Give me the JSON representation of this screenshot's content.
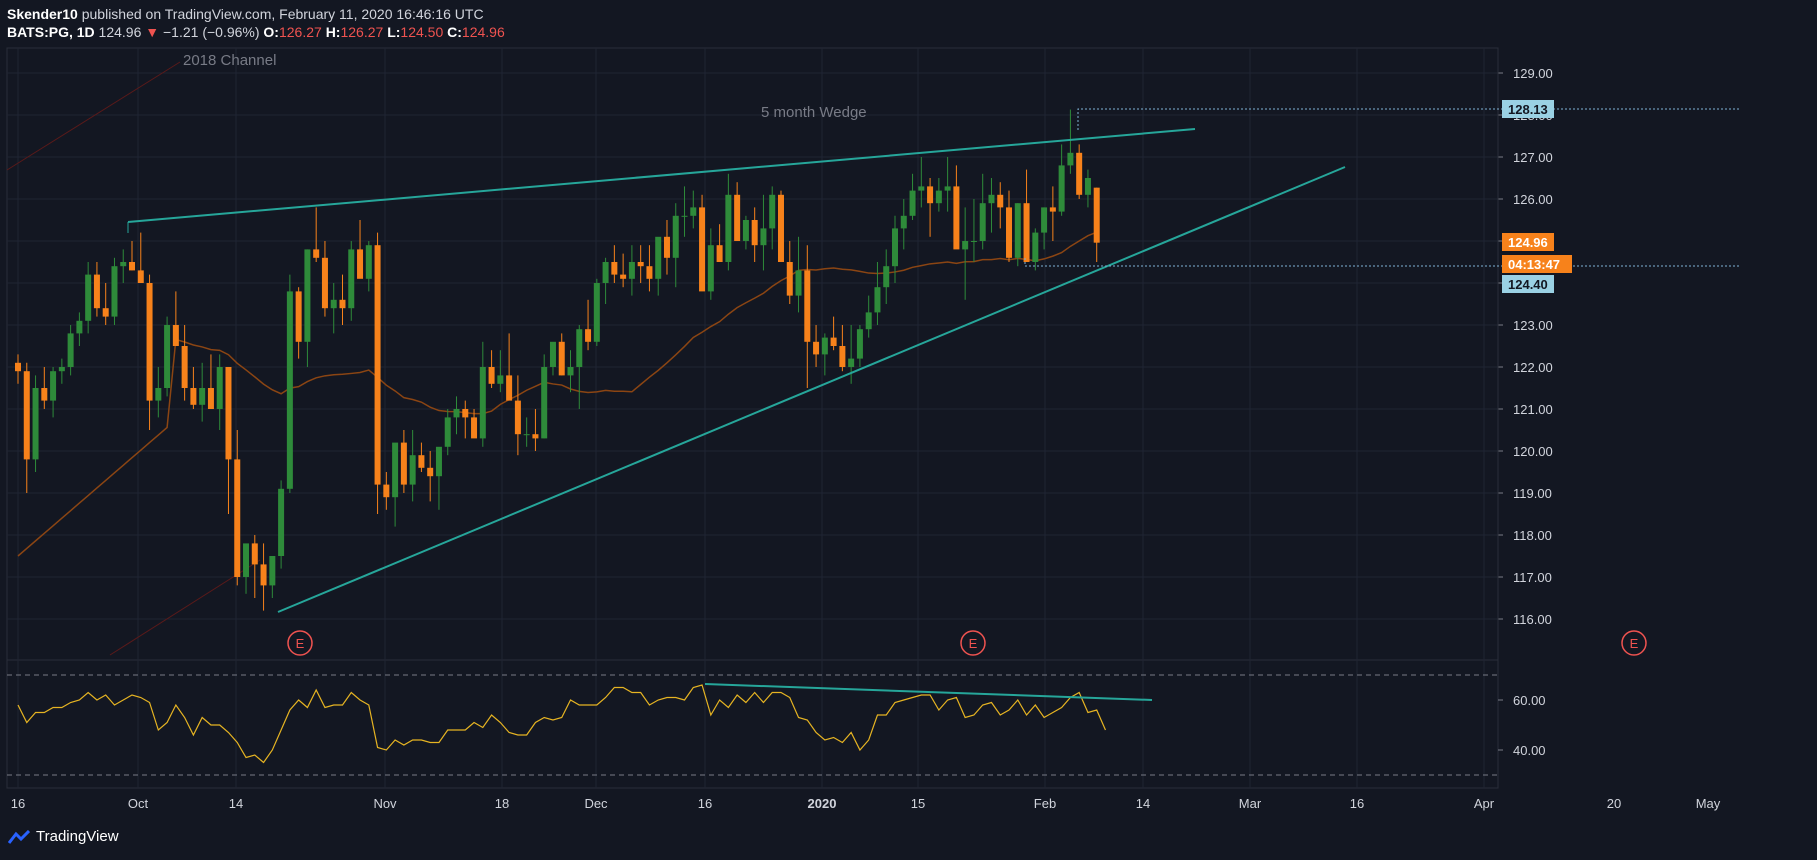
{
  "header": {
    "author": "Skender10",
    "published": "published on TradingView.com, February 11, 2020 16:46:16 UTC",
    "symbol": "BATS:PG, 1D",
    "last": "124.96",
    "arrow": "▼",
    "change": "−1.21 (−0.96%)",
    "o_label": "O:",
    "o_val": "126.27",
    "h_label": "H:",
    "h_val": "126.27",
    "l_label": "L:",
    "l_val": "124.50",
    "c_label": "C:",
    "c_val": "124.96"
  },
  "footer": {
    "brand": "TradingView"
  },
  "colors": {
    "background": "#131722",
    "up": "#2e8b3a",
    "down": "#f7821b",
    "trendline": "#26a69a",
    "ma": "#8b4513",
    "rsi": "#e6b422",
    "earnings": "#ef5350",
    "grid": "#1f2433"
  },
  "chart_data": {
    "type": "candlestick",
    "y_ticks": [
      "129.00",
      "128.00",
      "127.00",
      "126.00",
      "125.00",
      "124.00",
      "123.00",
      "122.00",
      "121.00",
      "120.00",
      "119.00",
      "118.00",
      "117.00",
      "116.00"
    ],
    "ylim": [
      115.0,
      129.5
    ],
    "x_ticks": [
      "16",
      "Oct",
      "14",
      "Nov",
      "18",
      "Dec",
      "16",
      "2020",
      "15",
      "Feb",
      "14",
      "Mar",
      "16",
      "Apr",
      "20",
      "May"
    ],
    "price_labels": {
      "high_mark": "128.13",
      "last": "124.96",
      "countdown": "04:13:47",
      "low_mark": "124.40"
    },
    "annotations": {
      "wedge": "5 month Wedge",
      "channel": "2018 Channel",
      "earnings": "E"
    },
    "candles": [
      [
        122.1,
        122.3,
        121.6,
        121.9
      ],
      [
        121.9,
        122.1,
        119.0,
        119.8
      ],
      [
        119.8,
        121.8,
        119.5,
        121.5
      ],
      [
        121.5,
        122.0,
        121.0,
        121.2
      ],
      [
        121.2,
        122.0,
        120.8,
        121.9
      ],
      [
        121.9,
        122.2,
        121.6,
        122.0
      ],
      [
        122.0,
        123.0,
        121.8,
        122.8
      ],
      [
        122.8,
        123.3,
        122.5,
        123.1
      ],
      [
        123.1,
        124.5,
        122.8,
        124.2
      ],
      [
        124.2,
        124.5,
        123.2,
        123.4
      ],
      [
        123.4,
        124.0,
        123.0,
        123.2
      ],
      [
        123.2,
        124.6,
        123.0,
        124.4
      ],
      [
        124.4,
        124.8,
        124.0,
        124.5
      ],
      [
        124.5,
        125.0,
        124.3,
        124.3
      ],
      [
        124.3,
        125.2,
        124.0,
        124.0
      ],
      [
        124.0,
        124.2,
        120.5,
        121.2
      ],
      [
        121.2,
        122.0,
        120.8,
        121.5
      ],
      [
        121.5,
        123.2,
        121.3,
        123.0
      ],
      [
        123.0,
        123.8,
        122.5,
        122.5
      ],
      [
        122.5,
        123.0,
        121.2,
        121.5
      ],
      [
        121.5,
        122.0,
        121.0,
        121.1
      ],
      [
        121.1,
        122.1,
        120.7,
        121.5
      ],
      [
        121.5,
        122.3,
        121.2,
        121.0
      ],
      [
        121.0,
        122.3,
        120.5,
        122.0
      ],
      [
        122.0,
        122.0,
        118.5,
        119.8
      ],
      [
        119.8,
        120.5,
        116.8,
        117.0
      ],
      [
        117.0,
        117.2,
        116.6,
        117.8
      ],
      [
        117.8,
        118.0,
        116.5,
        117.3
      ],
      [
        117.3,
        117.8,
        116.2,
        116.8
      ],
      [
        116.8,
        117.5,
        116.5,
        117.5
      ],
      [
        117.5,
        119.3,
        117.2,
        119.1
      ],
      [
        119.1,
        124.2,
        119.0,
        123.8
      ],
      [
        123.8,
        123.9,
        122.2,
        122.6
      ],
      [
        122.6,
        124.8,
        122.0,
        124.8
      ],
      [
        124.8,
        125.8,
        124.5,
        124.6
      ],
      [
        124.6,
        125.0,
        123.2,
        123.4
      ],
      [
        123.4,
        124.0,
        122.8,
        123.6
      ],
      [
        123.6,
        124.2,
        123.0,
        123.4
      ],
      [
        123.4,
        125.0,
        123.1,
        124.8
      ],
      [
        124.8,
        125.5,
        124.2,
        124.1
      ],
      [
        124.1,
        125.0,
        123.8,
        124.9
      ],
      [
        124.9,
        125.2,
        118.5,
        119.2
      ],
      [
        119.2,
        119.5,
        118.6,
        118.9
      ],
      [
        118.9,
        119.2,
        118.2,
        120.2
      ],
      [
        120.2,
        120.5,
        119.0,
        119.2
      ],
      [
        119.2,
        120.5,
        118.8,
        119.9
      ],
      [
        119.9,
        120.2,
        119.5,
        119.6
      ],
      [
        119.6,
        120.0,
        118.8,
        119.4
      ],
      [
        119.4,
        119.6,
        118.6,
        120.1
      ],
      [
        120.1,
        121.0,
        119.9,
        120.8
      ],
      [
        120.8,
        121.3,
        120.4,
        121.0
      ],
      [
        121.0,
        121.2,
        120.3,
        120.8
      ],
      [
        120.8,
        121.0,
        120.4,
        120.3
      ],
      [
        120.3,
        122.6,
        120.1,
        122.0
      ],
      [
        122.0,
        122.4,
        121.5,
        121.6
      ],
      [
        121.6,
        122.4,
        121.4,
        121.8
      ],
      [
        121.8,
        122.8,
        121.5,
        121.2
      ],
      [
        121.2,
        121.8,
        119.9,
        120.4
      ],
      [
        120.4,
        120.8,
        120.1,
        120.4
      ],
      [
        120.4,
        121.0,
        120.0,
        120.3
      ],
      [
        120.3,
        122.3,
        120.3,
        122.0
      ],
      [
        122.0,
        122.5,
        121.8,
        122.6
      ],
      [
        122.6,
        122.8,
        121.8,
        121.8
      ],
      [
        121.8,
        122.4,
        121.4,
        122.0
      ],
      [
        122.0,
        123.0,
        121.0,
        122.9
      ],
      [
        122.9,
        123.6,
        122.4,
        122.6
      ],
      [
        122.6,
        124.1,
        122.5,
        124.0
      ],
      [
        124.0,
        124.6,
        123.5,
        124.5
      ],
      [
        124.5,
        124.9,
        124.0,
        124.2
      ],
      [
        124.2,
        124.7,
        123.9,
        124.1
      ],
      [
        124.1,
        124.9,
        123.7,
        124.5
      ],
      [
        124.5,
        124.9,
        124.0,
        124.4
      ],
      [
        124.4,
        124.9,
        123.8,
        124.1
      ],
      [
        124.1,
        124.8,
        123.7,
        125.1
      ],
      [
        125.1,
        125.5,
        124.2,
        124.6
      ],
      [
        124.6,
        125.9,
        123.9,
        125.6
      ],
      [
        125.6,
        126.3,
        125.1,
        125.6
      ],
      [
        125.6,
        126.2,
        125.3,
        125.8
      ],
      [
        125.8,
        126.1,
        125.1,
        123.8
      ],
      [
        123.8,
        125.3,
        123.6,
        124.9
      ],
      [
        124.9,
        125.4,
        124.5,
        124.5
      ],
      [
        124.5,
        126.6,
        124.3,
        126.1
      ],
      [
        126.1,
        126.4,
        125.7,
        125.0
      ],
      [
        125.0,
        125.6,
        124.8,
        125.5
      ],
      [
        125.5,
        125.8,
        124.5,
        124.9
      ],
      [
        124.9,
        126.1,
        124.3,
        125.3
      ],
      [
        125.3,
        126.3,
        124.8,
        126.1
      ],
      [
        126.1,
        126.2,
        124.5,
        124.5
      ],
      [
        124.5,
        125.0,
        123.5,
        123.7
      ],
      [
        123.7,
        125.1,
        123.3,
        124.3
      ],
      [
        124.3,
        124.9,
        121.5,
        122.6
      ],
      [
        122.6,
        123.0,
        122.0,
        122.3
      ],
      [
        122.3,
        122.8,
        121.8,
        122.7
      ],
      [
        122.7,
        123.2,
        122.4,
        122.5
      ],
      [
        122.5,
        123.0,
        121.9,
        122.0
      ],
      [
        122.0,
        123.0,
        121.6,
        122.2
      ],
      [
        122.2,
        123.0,
        122.0,
        122.9
      ],
      [
        122.9,
        123.7,
        122.7,
        123.3
      ],
      [
        123.3,
        124.5,
        123.0,
        123.9
      ],
      [
        123.9,
        124.8,
        123.5,
        124.4
      ],
      [
        124.4,
        125.6,
        124.0,
        125.3
      ],
      [
        125.3,
        126.0,
        124.8,
        125.6
      ],
      [
        125.6,
        126.6,
        125.5,
        126.2
      ],
      [
        126.2,
        127.0,
        125.8,
        126.3
      ],
      [
        126.3,
        126.5,
        125.1,
        125.9
      ],
      [
        125.9,
        126.5,
        125.7,
        126.2
      ],
      [
        126.2,
        127.0,
        125.7,
        126.3
      ],
      [
        126.3,
        126.8,
        124.9,
        124.8
      ],
      [
        124.8,
        125.8,
        123.6,
        125.0
      ],
      [
        125.0,
        126.0,
        124.5,
        125.0
      ],
      [
        125.0,
        126.6,
        124.8,
        125.9
      ],
      [
        125.9,
        126.5,
        125.2,
        126.1
      ],
      [
        126.1,
        126.4,
        125.3,
        125.8
      ],
      [
        125.8,
        126.2,
        124.5,
        124.6
      ],
      [
        124.6,
        125.9,
        124.4,
        125.9
      ],
      [
        125.9,
        126.7,
        124.5,
        124.5
      ],
      [
        124.5,
        125.3,
        124.3,
        125.2
      ],
      [
        125.2,
        125.8,
        124.8,
        125.8
      ],
      [
        125.8,
        126.3,
        125.0,
        125.7
      ],
      [
        125.7,
        127.3,
        125.6,
        126.8
      ],
      [
        126.8,
        128.13,
        126.6,
        127.1
      ],
      [
        127.1,
        127.3,
        126.0,
        126.1
      ],
      [
        126.1,
        126.7,
        125.8,
        126.5
      ],
      [
        126.27,
        126.27,
        124.5,
        124.96
      ]
    ],
    "rsi": {
      "ylim": [
        30,
        75
      ],
      "ticks": [
        "60.00",
        "40.00"
      ],
      "bands": [
        70,
        30
      ],
      "values": [
        58,
        51,
        55,
        55,
        57,
        57,
        59,
        60,
        63,
        60,
        62,
        58,
        60,
        62,
        61,
        59,
        48,
        51,
        58,
        53,
        46,
        53,
        50,
        50,
        47,
        43,
        37,
        38,
        35,
        40,
        48,
        56,
        60,
        57,
        64,
        57,
        58,
        58,
        63,
        60,
        58,
        41,
        40,
        44,
        42,
        44,
        44,
        43,
        43,
        48,
        48,
        48,
        51,
        49,
        54,
        51,
        47,
        46,
        46,
        51,
        53,
        52,
        53,
        60,
        58,
        58,
        58,
        61,
        65,
        65,
        63,
        63,
        58,
        60,
        61,
        61,
        60,
        65,
        66,
        54,
        60,
        57,
        62,
        59,
        63,
        59,
        63,
        63,
        61,
        53,
        52,
        47,
        44,
        45,
        43,
        47,
        40,
        44,
        54,
        54,
        59,
        60,
        61,
        62,
        62,
        56,
        60,
        61,
        53,
        54,
        58,
        59,
        54,
        56,
        60,
        54,
        58,
        53,
        55,
        57,
        61,
        63,
        55,
        56,
        48
      ]
    }
  }
}
